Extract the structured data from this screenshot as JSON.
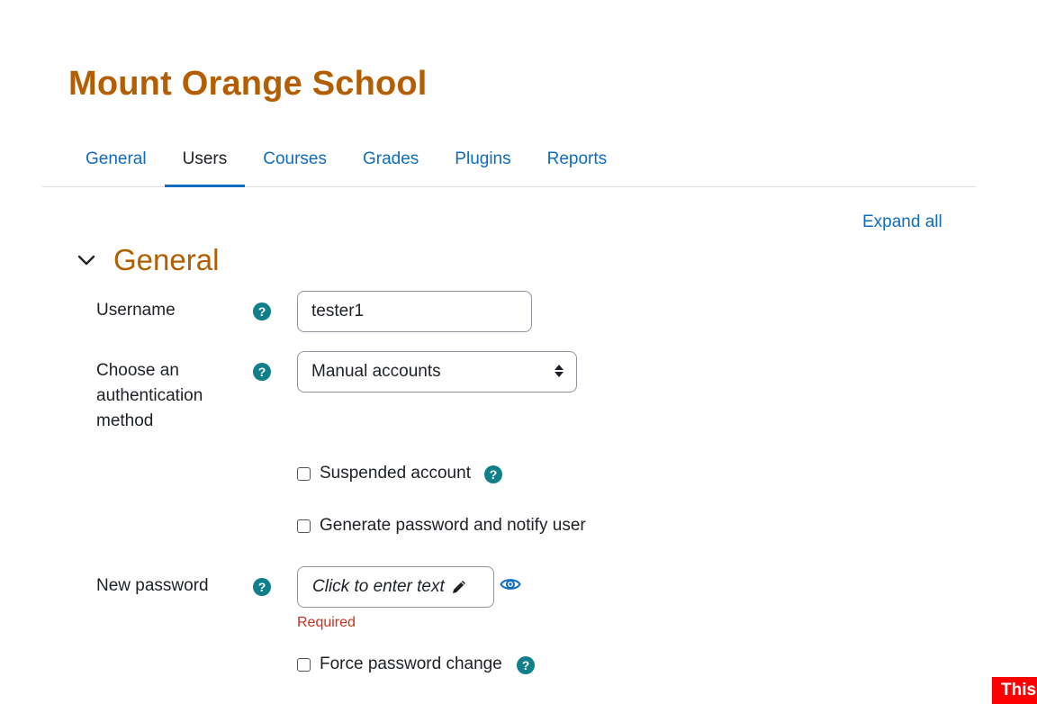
{
  "site": {
    "title": "Mount Orange School"
  },
  "tabs": [
    {
      "label": "General"
    },
    {
      "label": "Users",
      "active": true
    },
    {
      "label": "Courses"
    },
    {
      "label": "Grades"
    },
    {
      "label": "Plugins"
    },
    {
      "label": "Reports"
    }
  ],
  "expand_all_label": "Expand all",
  "section": {
    "title": "General",
    "icon": "chevron-down-icon"
  },
  "form": {
    "username_label": "Username",
    "username_value": "tester1",
    "auth_label": "Choose an authentication method",
    "auth_value": "Manual accounts",
    "suspended_label": "Suspended account",
    "generate_password_label": "Generate password and notify user",
    "new_password_label": "New password",
    "new_password_placeholder": "Click to enter text",
    "required_label": "Required",
    "force_change_label": "Force password change"
  },
  "help_glyph": "?",
  "corner_badge": "This",
  "colors": {
    "accent": "#0f6cbf",
    "title": "#b35e00",
    "help": "#0f7f8a",
    "error": "#ca3120",
    "badge": "#ff0000"
  }
}
